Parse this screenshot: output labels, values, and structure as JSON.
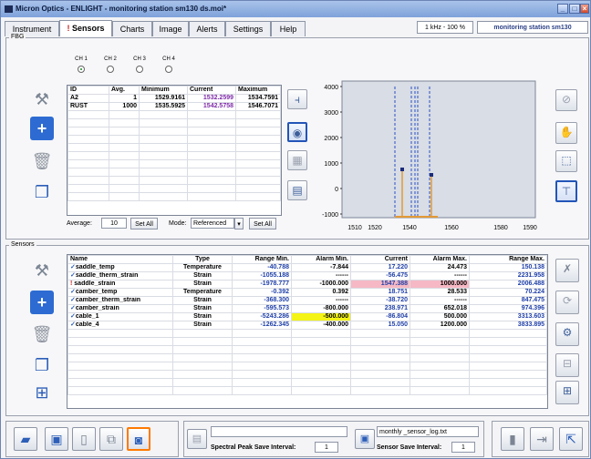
{
  "window": {
    "title": "Micron Optics - ENLIGHT - monitoring station sm130 ds.moi*"
  },
  "tabs": [
    {
      "label": "Instrument"
    },
    {
      "label": "Sensors"
    },
    {
      "label": "Charts"
    },
    {
      "label": "Image"
    },
    {
      "label": "Alerts"
    },
    {
      "label": "Settings"
    },
    {
      "label": "Help"
    }
  ],
  "status": {
    "rate": "1 kHz - 100 %",
    "station": "monitoring station sm130"
  },
  "fbg": {
    "title": "FBG",
    "channels": [
      "CH 1",
      "CH 2",
      "CH 3",
      "CH 4"
    ],
    "table": {
      "headers": [
        "ID",
        "Avg.",
        "Minimum",
        "Current",
        "Maximum"
      ],
      "rows": [
        [
          "A2",
          "1",
          "1529.9161",
          "1532.2599",
          "1534.7591"
        ],
        [
          "RUST",
          "1000",
          "1535.5925",
          "1542.5758",
          "1546.7071"
        ]
      ]
    },
    "average_label": "Average:",
    "average_value": "10",
    "set_all_label": "Set All",
    "mode_label": "Mode:",
    "mode_value": "Referenced"
  },
  "spectrum": {
    "y_ticks": [
      "4000",
      "3000",
      "2000",
      "1000",
      "0",
      "-1000"
    ],
    "x_ticks": [
      "1510",
      "1520",
      "1540",
      "1560",
      "1580",
      "1590"
    ]
  },
  "sensors": {
    "title": "Sensors",
    "headers": [
      "Name",
      "Type",
      "Range Min.",
      "Alarm Min.",
      "Current",
      "Alarm Max.",
      "Range Max."
    ],
    "rows": [
      {
        "name": "saddle_temp",
        "type": "Temperature",
        "range_min": "-40.788",
        "alarm_min": "-7.844",
        "current": "17.220",
        "alarm_max": "24.473",
        "range_max": "150.138"
      },
      {
        "name": "saddle_therm_strain",
        "type": "Strain",
        "range_min": "-1055.188",
        "alarm_min": "------",
        "current": "-56.475",
        "alarm_max": "------",
        "range_max": "2231.958"
      },
      {
        "name": "saddle_strain",
        "type": "Strain",
        "range_min": "-1978.777",
        "alarm_min": "-1000.000",
        "current": "1547.388",
        "alarm_max": "1000.000",
        "range_max": "2006.488"
      },
      {
        "name": "camber_temp",
        "type": "Temperature",
        "range_min": "-0.392",
        "alarm_min": "0.392",
        "current": "18.751",
        "alarm_max": "28.533",
        "range_max": "70.224"
      },
      {
        "name": "camber_therm_strain",
        "type": "Strain",
        "range_min": "-368.300",
        "alarm_min": "------",
        "current": "-38.720",
        "alarm_max": "------",
        "range_max": "847.475"
      },
      {
        "name": "camber_strain",
        "type": "Strain",
        "range_min": "-595.573",
        "alarm_min": "-800.000",
        "current": "238.971",
        "alarm_max": "652.018",
        "range_max": "974.396"
      },
      {
        "name": "cable_1",
        "type": "Strain",
        "range_min": "-5243.286",
        "alarm_min": "-500.000",
        "current": "-86.804",
        "alarm_max": "500.000",
        "range_max": "3313.603"
      },
      {
        "name": "cable_4",
        "type": "Strain",
        "range_min": "-1262.345",
        "alarm_min": "-400.000",
        "current": "15.050",
        "alarm_max": "1200.000",
        "range_max": "3833.895"
      }
    ]
  },
  "bottom": {
    "spectral_label": "Spectral Peak Save Interval:",
    "spectral_value": "1",
    "log_file": "monthly _sensor_log.txt",
    "sensor_label": "Sensor Save Interval:",
    "sensor_value": "1"
  },
  "colors": {
    "accent": "#2355b8",
    "alarm_high": "#f6b8c4",
    "alarm_low": "#f4f416",
    "marker": "#c42020"
  }
}
